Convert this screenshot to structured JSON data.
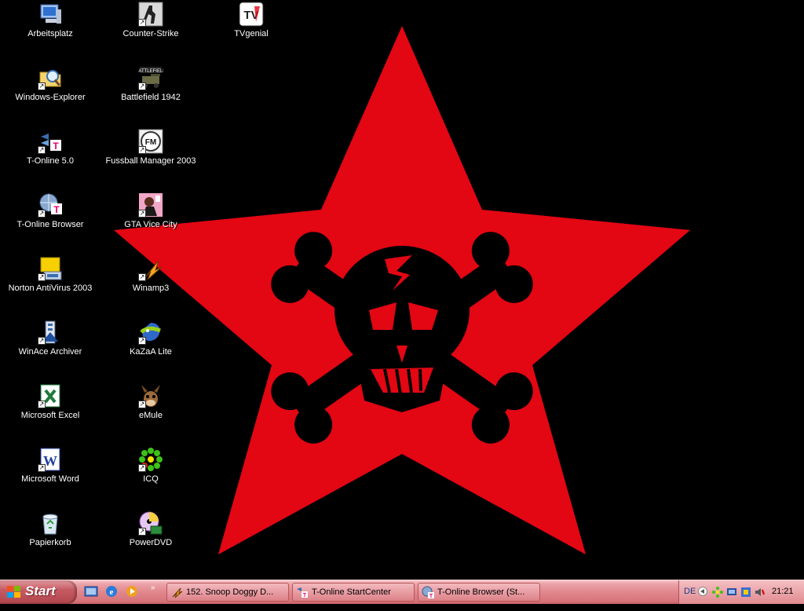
{
  "desktop": {
    "icons_col1": [
      {
        "label": "Arbeitsplatz",
        "icon": "my-computer-icon",
        "shortcut": false
      },
      {
        "label": "Windows-Explorer",
        "icon": "explorer-icon",
        "shortcut": true
      },
      {
        "label": "T-Online 5.0",
        "icon": "t-online-icon",
        "shortcut": true
      },
      {
        "label": "T-Online Browser",
        "icon": "t-online-browser-icon",
        "shortcut": true
      },
      {
        "label": "Norton AntiVirus 2003",
        "icon": "norton-antivirus-icon",
        "shortcut": true
      },
      {
        "label": "WinAce Archiver",
        "icon": "winace-icon",
        "shortcut": true
      },
      {
        "label": "Microsoft Excel",
        "icon": "excel-icon",
        "shortcut": true
      },
      {
        "label": "Microsoft Word",
        "icon": "word-icon",
        "shortcut": true
      },
      {
        "label": "Papierkorb",
        "icon": "recycle-bin-icon",
        "shortcut": false
      }
    ],
    "icons_col2": [
      {
        "label": "Counter-Strike",
        "icon": "counter-strike-icon",
        "shortcut": true
      },
      {
        "label": "Battlefield 1942",
        "icon": "battlefield-icon",
        "shortcut": true
      },
      {
        "label": "Fussball Manager 2003",
        "icon": "fussball-manager-icon",
        "shortcut": true
      },
      {
        "label": "GTA Vice City",
        "icon": "gta-vice-city-icon",
        "shortcut": true
      },
      {
        "label": "Winamp3",
        "icon": "winamp-icon",
        "shortcut": true
      },
      {
        "label": "KaZaA Lite",
        "icon": "kazaa-icon",
        "shortcut": true
      },
      {
        "label": "eMule",
        "icon": "emule-icon",
        "shortcut": true
      },
      {
        "label": "ICQ",
        "icon": "icq-icon",
        "shortcut": true
      },
      {
        "label": "PowerDVD",
        "icon": "powerdvd-icon",
        "shortcut": true
      }
    ],
    "icons_col3": [
      {
        "label": "TVgenial",
        "icon": "tvgenial-icon",
        "shortcut": false
      }
    ],
    "wallpaper": {
      "star_color": "#e30613",
      "background": "#000000",
      "motif": "skull-and-crossbones-star"
    }
  },
  "taskbar": {
    "start_label": "Start",
    "quicklaunch": [
      "desktop-icon",
      "internet-explorer-icon",
      "media-player-icon"
    ],
    "quicklaunch_more": "»",
    "tasks": [
      {
        "label": "152. Snoop Doggy D...",
        "icon": "winamp-icon"
      },
      {
        "label": "T-Online StartCenter",
        "icon": "t-online-icon"
      },
      {
        "label": "T-Online Browser (St...",
        "icon": "t-online-browser-icon"
      }
    ],
    "tray": {
      "language": "DE",
      "icons": [
        "icq-tray-icon",
        "network-icon",
        "antivirus-tray-icon",
        "volume-icon",
        "connection-icon"
      ],
      "clock": "21:21"
    },
    "colors": {
      "taskbar": "#e0878d",
      "start": "#b1454e"
    }
  }
}
